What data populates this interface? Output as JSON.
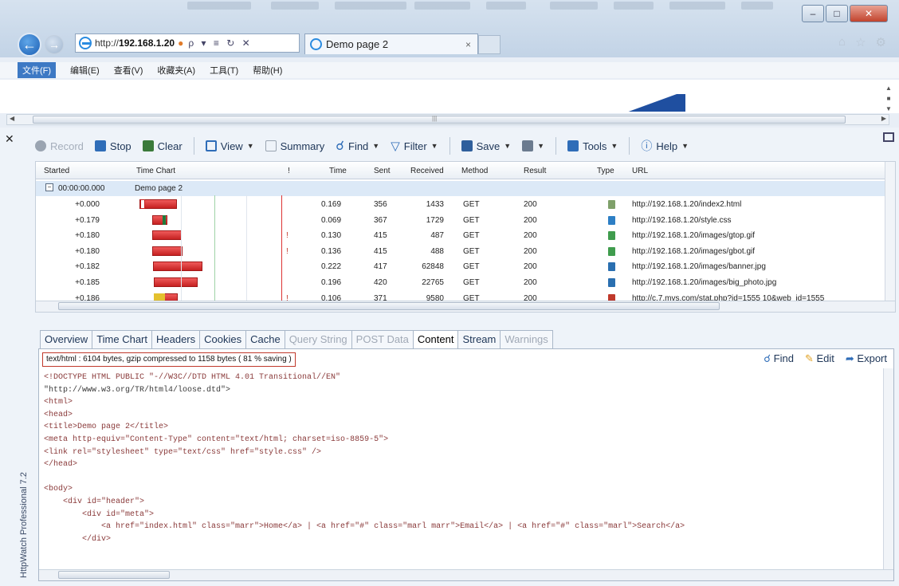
{
  "browser": {
    "address": {
      "prefix": "http://",
      "host": "192.168.1.20",
      "controls": "ρ ▾ ≡ ↻ ✕"
    },
    "tab_title": "Demo page 2",
    "tab_close": "×",
    "menu": [
      "文件(F)",
      "编辑(E)",
      "查看(V)",
      "收藏夹(A)",
      "工具(T)",
      "帮助(H)"
    ],
    "window_controls": {
      "minimize": "–",
      "maximize": "□",
      "close": "✕"
    },
    "scroll_marker": "|||"
  },
  "httpwatch": {
    "side_label": "HttpWatch Professional 7.2",
    "toolbar": {
      "record": "Record",
      "stop": "Stop",
      "clear": "Clear",
      "view": "View",
      "summary": "Summary",
      "find": "Find",
      "filter": "Filter",
      "save": "Save",
      "tools": "Tools",
      "help": "Help"
    },
    "columns": {
      "started": "Started",
      "time_chart": "Time Chart",
      "warn": "!",
      "time": "Time",
      "sent": "Sent",
      "received": "Received",
      "method": "Method",
      "result": "Result",
      "type": "Type",
      "url": "URL"
    },
    "page_row": {
      "started": "00:00:00.000",
      "title": "Demo page 2"
    },
    "rows": [
      {
        "started": "+0.000",
        "warn": "",
        "time": "0.169",
        "sent": "356",
        "received": "1433",
        "method": "GET",
        "result": "200",
        "url": "http://192.168.1.20/index2.html",
        "type_color": "#7fa06a"
      },
      {
        "started": "+0.179",
        "warn": "",
        "time": "0.069",
        "sent": "367",
        "received": "1729",
        "method": "GET",
        "result": "200",
        "url": "http://192.168.1.20/style.css",
        "type_color": "#2d7fc5"
      },
      {
        "started": "+0.180",
        "warn": "!",
        "time": "0.130",
        "sent": "415",
        "received": "487",
        "method": "GET",
        "result": "200",
        "url": "http://192.168.1.20/images/gtop.gif",
        "type_color": "#3f9c4d"
      },
      {
        "started": "+0.180",
        "warn": "!",
        "time": "0.136",
        "sent": "415",
        "received": "488",
        "method": "GET",
        "result": "200",
        "url": "http://192.168.1.20/images/gbot.gif",
        "type_color": "#3f9c4d"
      },
      {
        "started": "+0.182",
        "warn": "",
        "time": "0.222",
        "sent": "417",
        "received": "62848",
        "method": "GET",
        "result": "200",
        "url": "http://192.168.1.20/images/banner.jpg",
        "type_color": "#2a6fb0"
      },
      {
        "started": "+0.185",
        "warn": "",
        "time": "0.196",
        "sent": "420",
        "received": "22765",
        "method": "GET",
        "result": "200",
        "url": "http://192.168.1.20/images/big_photo.jpg",
        "type_color": "#2a6fb0"
      },
      {
        "started": "+0.186",
        "warn": "!",
        "time": "0.106",
        "sent": "371",
        "received": "9580",
        "method": "GET",
        "result": "200",
        "url": "http://c.7.mvs.com/stat.php?id=1555 10&web_id=1555",
        "type_color": "#c0392b"
      }
    ],
    "bars": [
      {
        "start": 0.0,
        "dur": 0.169,
        "kind": "first"
      },
      {
        "start": 0.179,
        "dur": 0.069,
        "kind": "css"
      },
      {
        "start": 0.18,
        "dur": 0.13,
        "kind": "red"
      },
      {
        "start": 0.18,
        "dur": 0.136,
        "kind": "red"
      },
      {
        "start": 0.182,
        "dur": 0.222,
        "kind": "red"
      },
      {
        "start": 0.185,
        "dur": 0.196,
        "kind": "red"
      },
      {
        "start": 0.186,
        "dur": 0.106,
        "kind": "stat"
      }
    ],
    "detail_tabs": [
      {
        "label": "Overview",
        "state": "normal"
      },
      {
        "label": "Time Chart",
        "state": "normal"
      },
      {
        "label": "Headers",
        "state": "normal"
      },
      {
        "label": "Cookies",
        "state": "normal"
      },
      {
        "label": "Cache",
        "state": "normal"
      },
      {
        "label": "Query String",
        "state": "dim"
      },
      {
        "label": "POST Data",
        "state": "dim"
      },
      {
        "label": "Content",
        "state": "active"
      },
      {
        "label": "Stream",
        "state": "normal"
      },
      {
        "label": "Warnings",
        "state": "dim"
      }
    ],
    "content_info": "text/html : 6104 bytes, gzip compressed to 1158 bytes ( 81 % saving )",
    "content_actions": {
      "find": "Find",
      "edit": "Edit",
      "export": "Export"
    },
    "source_lines": [
      "<!DOCTYPE HTML PUBLIC \"-//W3C//DTD HTML 4.01 Transitional//EN\"",
      "\"http://www.w3.org/TR/html4/loose.dtd\">",
      "<html>",
      "<head>",
      "<title>Demo page 2</title>",
      "<meta http-equiv=\"Content-Type\" content=\"text/html; charset=iso-8859-5\">",
      "<link rel=\"stylesheet\" type=\"text/css\" href=\"style.css\" />",
      "</head>",
      "",
      "<body>",
      "    <div id=\"header\">",
      "        <div id=\"meta\">",
      "            <a href=\"index.html\" class=\"marr\">Home</a> | <a href=\"#\" class=\"marl marr\">Email</a> | <a href=\"#\" class=\"marl\">Search</a>",
      "        </div>"
    ]
  },
  "colors": {
    "accent": "#1f4fa0",
    "bar_red": "#d32f2f",
    "info_border": "#c0392b"
  }
}
